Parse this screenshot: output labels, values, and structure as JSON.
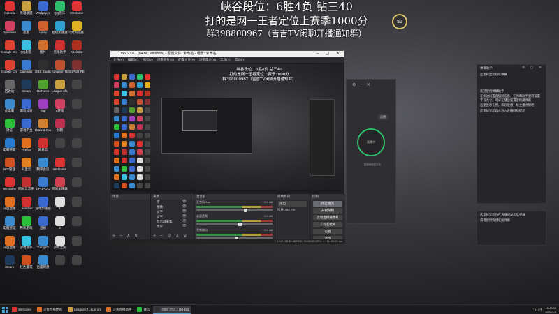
{
  "overlay": {
    "line1": "峡谷段位：6胜4负 钻三40",
    "line2": "打的是网一王者定位上赛季1000分",
    "line3": "群398800967（吉吉TV闲聊开播通知群）",
    "speed_badge": "52"
  },
  "desktop_icons": [
    {
      "label": "Garena",
      "color": "#d33"
    },
    {
      "label": "英雄联盟",
      "color": "#c8a040"
    },
    {
      "label": "Wallpaper",
      "color": "#3a6ad0"
    },
    {
      "label": "QQ音乐",
      "color": "#2bbf6a"
    },
    {
      "label": "WeGame",
      "color": "#d33"
    },
    {
      "label": "OpenSee",
      "color": "#d04060"
    },
    {
      "label": "迅雷",
      "color": "#3a8ad0"
    },
    {
      "label": "uplay",
      "color": "#d06030"
    },
    {
      "label": "超级加速器",
      "color": "#30a0d0"
    },
    {
      "label": "QQ浏览器",
      "color": "#e0b020"
    },
    {
      "label": "Google Chrome",
      "color": "#e04030"
    },
    {
      "label": "QQ影音",
      "color": "#3ac0e0"
    },
    {
      "label": "图片",
      "color": "#d07030"
    },
    {
      "label": "无限助手",
      "color": "#d03030"
    },
    {
      "label": "Rockstar",
      "color": "#b03020"
    },
    {
      "label": "Google Chrome",
      "color": "#e04030"
    },
    {
      "label": "Calendar",
      "color": "#3a7ad0"
    },
    {
      "label": "OBS Studio",
      "color": "#303030"
    },
    {
      "label": "Kingdom Rush",
      "color": "#c05030"
    },
    {
      "label": "SUPER PEOPLE",
      "color": "#803030"
    },
    {
      "label": "回收站",
      "color": "#666"
    },
    {
      "label": "Steam",
      "color": "#1e3a5a"
    },
    {
      "label": "GeForce",
      "color": "#50a030"
    },
    {
      "label": "League of Legends",
      "color": "#c8a040"
    },
    {
      "label": "",
      "color": "#444"
    },
    {
      "label": "此电脑",
      "color": "#3a8ad0"
    },
    {
      "label": "游戏加速",
      "color": "#3a6ad0"
    },
    {
      "label": "Yap",
      "color": "#a040c0"
    },
    {
      "label": "9游戏",
      "color": "#d04060"
    },
    {
      "label": "",
      "color": "#444"
    },
    {
      "label": "微信",
      "color": "#2bbf3a"
    },
    {
      "label": "游戏平台",
      "color": "#3a6ad0"
    },
    {
      "label": "Draw & Guess",
      "color": "#d08030"
    },
    {
      "label": "剑网",
      "color": "#c03050"
    },
    {
      "label": "",
      "color": "#444"
    },
    {
      "label": "电脑管家",
      "color": "#2a7ad0"
    },
    {
      "label": "Firefox",
      "color": "#e07020"
    },
    {
      "label": "网易云",
      "color": "#d03030"
    },
    {
      "label": "",
      "color": "#444"
    },
    {
      "label": "",
      "color": "#444"
    },
    {
      "label": "IEO管理",
      "color": "#d05020"
    },
    {
      "label": "阿里云",
      "color": "#e08020"
    },
    {
      "label": "腾讯会议",
      "color": "#3a8ad0"
    },
    {
      "label": "WeGame",
      "color": "#d33"
    },
    {
      "label": "",
      "color": "#444"
    },
    {
      "label": "WeGame",
      "color": "#d33"
    },
    {
      "label": "网易云音乐",
      "color": "#c03030"
    },
    {
      "label": "UPUPOO",
      "color": "#3a7ad0"
    },
    {
      "label": "网易加速器",
      "color": "#d04050"
    },
    {
      "label": "",
      "color": "#444"
    },
    {
      "label": "斗鱼直播",
      "color": "#e07020"
    },
    {
      "label": "Launcher",
      "color": "#d03030"
    },
    {
      "label": "游戏加速器",
      "color": "#3a6ad0"
    },
    {
      "label": "1",
      "color": "#ddd"
    },
    {
      "label": "",
      "color": "#444"
    },
    {
      "label": "电脑管理",
      "color": "#3a8ad0"
    },
    {
      "label": "腾讯游戏",
      "color": "#2bbf3a"
    },
    {
      "label": "直播",
      "color": "#3a6ad0"
    },
    {
      "label": "2",
      "color": "#ddd"
    },
    {
      "label": "",
      "color": "#444"
    },
    {
      "label": "斗鱼直播",
      "color": "#e07020"
    },
    {
      "label": "游戏助手",
      "color": "#3ac0e0"
    },
    {
      "label": "GangsO",
      "color": "#3a8ad0"
    },
    {
      "label": "游戏之家",
      "color": "#ddd"
    },
    {
      "label": "",
      "color": "#444"
    },
    {
      "label": "Steam",
      "color": "#1e3a5a"
    },
    {
      "label": "红色警戒",
      "color": "#d05020"
    },
    {
      "label": "百度网盘",
      "color": "#3a8ad0"
    },
    {
      "label": "",
      "color": "#444"
    },
    {
      "label": "",
      "color": "#444"
    }
  ],
  "obs": {
    "title": "OBS 27.0.1 (64-bit, windows) - 配置文件: 未命名 - 场景: 未命名",
    "menu": [
      "文件(F)",
      "编辑(E)",
      "视图(V)",
      "停靠部件(D)",
      "配置文件(P)",
      "场景集合(S)",
      "工具(T)",
      "帮助(H)"
    ],
    "preview_text": [
      "峡谷段位：6胜4负 钻三40",
      "打的是网一王者定位上赛季1000分",
      "群398800967（吉吉TV闲聊开播通知群）"
    ],
    "docks": {
      "scenes_title": "场景",
      "sources_title": "来源",
      "mixer_title": "混音器",
      "transitions_title": "转场特效",
      "controls_title": "控制"
    },
    "sources": [
      "字",
      "图像",
      "文字",
      "文字",
      "显示器采集",
      "文字"
    ],
    "mixer": [
      {
        "name": "麦克风/Aux",
        "db": "0.0 dB",
        "level": 0.62
      },
      {
        "name": "桌面音频",
        "db": "0.0 dB",
        "level": 0.55
      },
      {
        "name": "音频输出",
        "db": "0.0 dB",
        "level": 0.5
      }
    ],
    "transition": {
      "type": "淡出",
      "duration_label": "时长",
      "duration": "300 ms"
    },
    "controls": [
      "停止推流",
      "开始录制",
      "启动虚拟摄像机",
      "工作室模式",
      "设置",
      "退出"
    ],
    "status": "LIVE: 00:33:48   REC: 00:00:00   CPU: 4.1%, 60.00 fps"
  },
  "bg_app": {
    "toolbar_icons": [
      "gear-icon",
      "minimize-icon",
      "close-icon"
    ],
    "circle_label": "直播中",
    "pill_label": "设置",
    "caption": "直播画面显示中"
  },
  "chat_top": {
    "title": "弹幕助手",
    "messages": [
      "这里将显示观众弹幕",
      "欢迎使用弹幕助手",
      "在侧边设置直播间信息，在弹幕助手里可设置字号大小，可以在播放设置里隐藏弹幕",
      "这里显示礼物，欢迎使用，给主播点赞吧",
      "这里将显示观众进入直播间的提示"
    ]
  },
  "chat_bottom": {
    "messages": [
      "这里将显示你在直播间发出的弹幕",
      "或者使用快捷发送弹幕"
    ]
  },
  "taskbar": {
    "items": [
      {
        "label": "WeGame",
        "color": "#d33",
        "active": false
      },
      {
        "label": "斗鱼直播伴侣",
        "color": "#e07020",
        "active": false
      },
      {
        "label": "League of Legends",
        "color": "#c8a040",
        "active": false
      },
      {
        "label": "斗鱼直播助手",
        "color": "#e07020",
        "active": false
      },
      {
        "label": "微信",
        "color": "#2bbf3a",
        "active": false
      },
      {
        "label": "OBS 27.0.1 (64-bit)",
        "color": "#303030",
        "active": true
      }
    ],
    "time": "15:48:02",
    "date": "2022/1/3"
  }
}
